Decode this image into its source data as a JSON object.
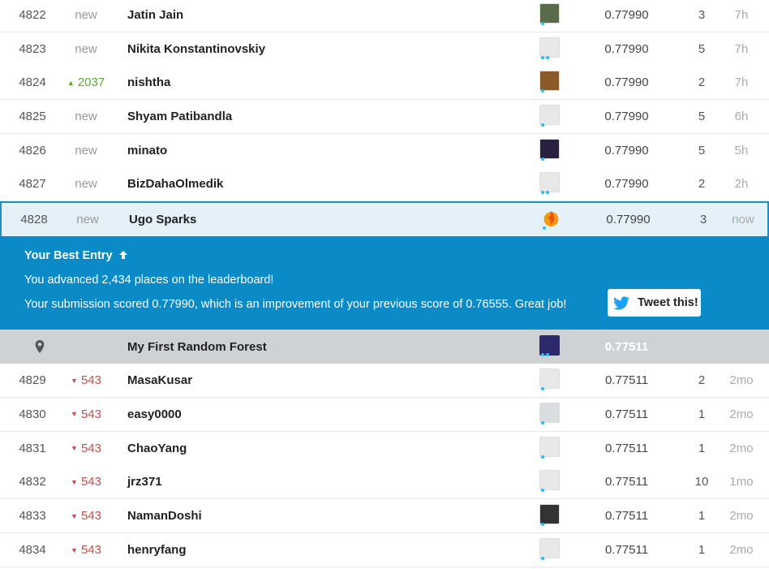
{
  "rows_top": [
    {
      "rank": "4822",
      "delta": "new",
      "delta_type": "new",
      "name": "Jatin Jain",
      "avatar": "photo-avatar",
      "avatar_color": "#5a6b4a",
      "dots": 1,
      "score": "0.77990",
      "entries": "3",
      "last": "7h"
    },
    {
      "rank": "4823",
      "delta": "new",
      "delta_type": "new",
      "name": "Nikita Konstantinovskiy",
      "avatar": "default-avatar",
      "avatar_color": "#e8e8e8",
      "dots": 2,
      "score": "0.77990",
      "entries": "5",
      "last": "7h"
    },
    {
      "rank": "4824",
      "delta": "2037",
      "delta_type": "up",
      "name": "nishtha",
      "avatar": "photo-avatar",
      "avatar_color": "#8b5a2b",
      "dots": 1,
      "score": "0.77990",
      "entries": "2",
      "last": "7h"
    },
    {
      "rank": "4825",
      "delta": "new",
      "delta_type": "new",
      "name": "Shyam Patibandla",
      "avatar": "default-avatar",
      "avatar_color": "#e8e8e8",
      "dots": 1,
      "score": "0.77990",
      "entries": "5",
      "last": "6h"
    },
    {
      "rank": "4826",
      "delta": "new",
      "delta_type": "new",
      "name": "minato",
      "avatar": "photo-avatar",
      "avatar_color": "#2a2040",
      "dots": 1,
      "score": "0.77990",
      "entries": "5",
      "last": "5h"
    },
    {
      "rank": "4827",
      "delta": "new",
      "delta_type": "new",
      "name": "BizDahaOlmedik",
      "avatar": "default-avatar",
      "avatar_color": "#e8e8e8",
      "dots": 2,
      "score": "0.77990",
      "entries": "2",
      "last": "2h"
    }
  ],
  "me_row": {
    "rank": "4828",
    "delta": "new",
    "name": "Ugo Sparks",
    "score": "0.77990",
    "entries": "3",
    "last": "now"
  },
  "banner": {
    "title": "Your Best Entry",
    "line1": "You advanced 2,434 places on the leaderboard!",
    "line2": "Your submission scored 0.77990, which is an improvement of your previous score of 0.76555. Great job!",
    "tweet_label": "Tweet this!"
  },
  "benchmark": {
    "name": "My First Random Forest",
    "score": "0.77511"
  },
  "rows_bottom": [
    {
      "rank": "4829",
      "delta": "543",
      "delta_type": "down",
      "name": "MasaKusar",
      "avatar": "default-avatar",
      "avatar_color": "#e8e8e8",
      "dots": 1,
      "score": "0.77511",
      "entries": "2",
      "last": "2mo"
    },
    {
      "rank": "4830",
      "delta": "543",
      "delta_type": "down",
      "name": "easy0000",
      "avatar": "photo-avatar",
      "avatar_color": "#d8dde0",
      "dots": 1,
      "score": "0.77511",
      "entries": "1",
      "last": "2mo"
    },
    {
      "rank": "4831",
      "delta": "543",
      "delta_type": "down",
      "name": "ChaoYang",
      "avatar": "default-avatar",
      "avatar_color": "#e8e8e8",
      "dots": 1,
      "score": "0.77511",
      "entries": "1",
      "last": "2mo"
    },
    {
      "rank": "4832",
      "delta": "543",
      "delta_type": "down",
      "name": "jrz371",
      "avatar": "default-avatar",
      "avatar_color": "#e8e8e8",
      "dots": 1,
      "score": "0.77511",
      "entries": "10",
      "last": "1mo"
    },
    {
      "rank": "4833",
      "delta": "543",
      "delta_type": "down",
      "name": "NamanDoshi",
      "avatar": "photo-avatar",
      "avatar_color": "#333333",
      "dots": 1,
      "score": "0.77511",
      "entries": "1",
      "last": "2mo"
    },
    {
      "rank": "4834",
      "delta": "543",
      "delta_type": "down",
      "name": "henryfang",
      "avatar": "default-avatar",
      "avatar_color": "#e8e8e8",
      "dots": 1,
      "score": "0.77511",
      "entries": "1",
      "last": "2mo"
    }
  ],
  "colors": {
    "accent": "#0b8ac8",
    "up": "#5aa832",
    "down": "#c0504d",
    "dot": "#20beff"
  }
}
